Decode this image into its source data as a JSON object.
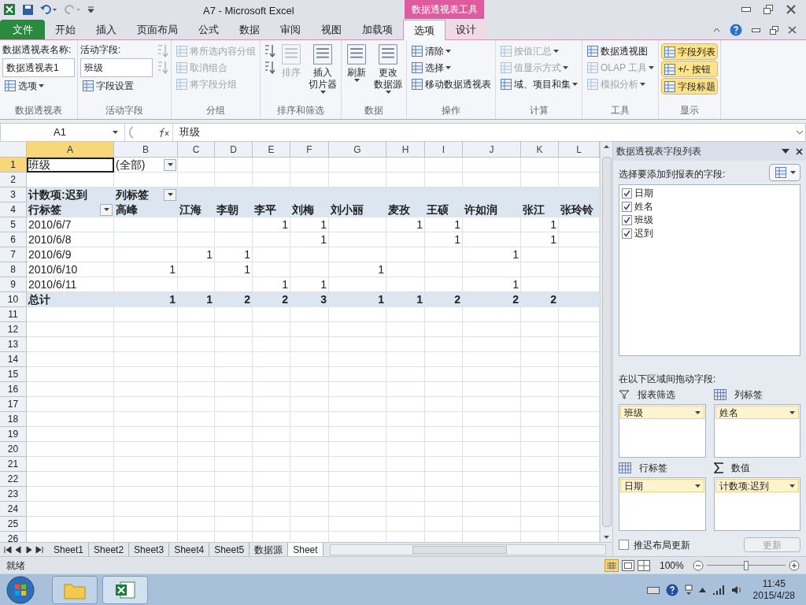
{
  "window": {
    "title": "A7  -  Microsoft Excel",
    "context_title": "数据透视表工具"
  },
  "tabs": [
    {
      "label": "文件",
      "kind": "file",
      "selected": false
    },
    {
      "label": "开始",
      "kind": "normal",
      "selected": false
    },
    {
      "label": "插入",
      "kind": "normal",
      "selected": false
    },
    {
      "label": "页面布局",
      "kind": "normal",
      "selected": false
    },
    {
      "label": "公式",
      "kind": "normal",
      "selected": false
    },
    {
      "label": "数据",
      "kind": "normal",
      "selected": false
    },
    {
      "label": "审阅",
      "kind": "normal",
      "selected": false
    },
    {
      "label": "视图",
      "kind": "normal",
      "selected": false
    },
    {
      "label": "加载项",
      "kind": "normal",
      "selected": false
    },
    {
      "label": "选项",
      "kind": "context",
      "selected": true
    },
    {
      "label": "设计",
      "kind": "context",
      "selected": false
    }
  ],
  "ribbon": [
    {
      "label": "数据透视表",
      "columns": [
        [
          {
            "kind": "field",
            "caption": "数据透视表名称:",
            "value": "数据透视表1"
          },
          {
            "kind": "small",
            "text": "选项",
            "dropdown": true,
            "disabled": false
          }
        ]
      ]
    },
    {
      "label": "活动字段",
      "columns": [
        [
          {
            "kind": "field",
            "caption": "活动字段:",
            "value": "班级"
          },
          {
            "kind": "small",
            "text": "字段设置",
            "dropdown": false,
            "disabled": false
          }
        ],
        [
          {
            "kind": "icon",
            "disabled": true
          },
          {
            "kind": "icon",
            "disabled": true
          }
        ]
      ]
    },
    {
      "label": "分组",
      "columns": [
        [
          {
            "kind": "small",
            "text": "将所选内容分组",
            "dropdown": false,
            "disabled": true
          },
          {
            "kind": "small",
            "text": "取消组合",
            "dropdown": false,
            "disabled": true
          },
          {
            "kind": "small",
            "text": "将字段分组",
            "dropdown": false,
            "disabled": true
          }
        ]
      ]
    },
    {
      "label": "排序和筛选",
      "columns": [
        [
          {
            "kind": "icon",
            "disabled": false
          },
          {
            "kind": "icon",
            "disabled": false
          }
        ],
        [
          {
            "kind": "large",
            "lines": [
              "排序"
            ],
            "dropdown": false,
            "disabled": true
          }
        ],
        [
          {
            "kind": "large",
            "lines": [
              "插入",
              "切片器"
            ],
            "dropdown": true,
            "disabled": false
          }
        ]
      ]
    },
    {
      "label": "数据",
      "columns": [
        [
          {
            "kind": "large",
            "lines": [
              "刷新"
            ],
            "dropdown": true,
            "disabled": false
          }
        ],
        [
          {
            "kind": "large",
            "lines": [
              "更改",
              "数据源"
            ],
            "dropdown": true,
            "disabled": false
          }
        ]
      ]
    },
    {
      "label": "操作",
      "columns": [
        [
          {
            "kind": "small",
            "text": "清除",
            "dropdown": true,
            "disabled": false
          },
          {
            "kind": "small",
            "text": "选择",
            "dropdown": true,
            "disabled": false
          },
          {
            "kind": "small",
            "text": "移动数据透视表",
            "dropdown": false,
            "disabled": false
          }
        ]
      ]
    },
    {
      "label": "计算",
      "columns": [
        [
          {
            "kind": "small",
            "text": "按值汇总",
            "dropdown": true,
            "disabled": true
          },
          {
            "kind": "small",
            "text": "值显示方式",
            "dropdown": true,
            "disabled": true
          },
          {
            "kind": "small",
            "text": "域、项目和集",
            "dropdown": true,
            "disabled": false
          }
        ]
      ]
    },
    {
      "label": "工具",
      "columns": [
        [
          {
            "kind": "small",
            "text": "数据透视图",
            "dropdown": false,
            "disabled": false
          },
          {
            "kind": "small",
            "text": "OLAP 工具",
            "dropdown": true,
            "disabled": true
          },
          {
            "kind": "small",
            "text": "模拟分析",
            "dropdown": true,
            "disabled": true
          }
        ]
      ]
    },
    {
      "label": "显示",
      "columns": [
        [
          {
            "kind": "toggle",
            "text": "字段列表",
            "selected": true
          },
          {
            "kind": "toggle",
            "text": "+/- 按钮",
            "selected": true
          },
          {
            "kind": "toggle",
            "text": "字段标题",
            "selected": true
          }
        ]
      ]
    }
  ],
  "formula_bar": {
    "name_box": "A1",
    "content": "班级"
  },
  "columns": [
    {
      "label": "A",
      "selected": true
    },
    {
      "label": "B",
      "selected": false
    },
    {
      "label": "C",
      "selected": false
    },
    {
      "label": "D",
      "selected": false
    },
    {
      "label": "E",
      "selected": false
    },
    {
      "label": "F",
      "selected": false
    },
    {
      "label": "G",
      "selected": false
    },
    {
      "label": "H",
      "selected": false
    },
    {
      "label": "I",
      "selected": false
    },
    {
      "label": "J",
      "selected": false
    },
    {
      "label": "K",
      "selected": false
    },
    {
      "label": "L",
      "selected": false
    }
  ],
  "rows": [
    {
      "number": "1",
      "kind": "filter",
      "selected": true,
      "cells": {
        "A": {
          "text": "班级",
          "active": true
        },
        "B": {
          "text": "(全部)",
          "dropdown": true
        }
      }
    },
    {
      "number": "2",
      "kind": "blank",
      "selected": false,
      "cells": {}
    },
    {
      "number": "3",
      "kind": "header",
      "selected": false,
      "cells": {
        "A": {
          "text": "计数项:迟到"
        },
        "B": {
          "text": "列标签",
          "dropdown": true
        }
      }
    },
    {
      "number": "4",
      "kind": "header",
      "selected": false,
      "cells": {
        "A": {
          "text": "行标签",
          "dropdown": true
        },
        "B": {
          "text": "高峰"
        },
        "C": {
          "text": "江海"
        },
        "D": {
          "text": "李朝"
        },
        "E": {
          "text": "李平"
        },
        "F": {
          "text": "刘梅"
        },
        "G": {
          "text": "刘小丽"
        },
        "H": {
          "text": "麦孜"
        },
        "I": {
          "text": "王硕"
        },
        "J": {
          "text": "许如润"
        },
        "K": {
          "text": "张江"
        },
        "L": {
          "text": "张玲铃"
        }
      }
    },
    {
      "number": "5",
      "kind": "data",
      "selected": false,
      "cells": {
        "A": {
          "text": "2010/6/7"
        },
        "E": {
          "text": "1"
        },
        "F": {
          "text": "1"
        },
        "H": {
          "text": "1"
        },
        "I": {
          "text": "1"
        },
        "K": {
          "text": "1"
        }
      }
    },
    {
      "number": "6",
      "kind": "data",
      "selected": false,
      "cells": {
        "A": {
          "text": "2010/6/8"
        },
        "F": {
          "text": "1"
        },
        "I": {
          "text": "1"
        },
        "K": {
          "text": "1"
        }
      }
    },
    {
      "number": "7",
      "kind": "data",
      "selected": false,
      "cells": {
        "A": {
          "text": "2010/6/9"
        },
        "C": {
          "text": "1"
        },
        "D": {
          "text": "1"
        },
        "J": {
          "text": "1"
        }
      }
    },
    {
      "number": "8",
      "kind": "data",
      "selected": false,
      "cells": {
        "A": {
          "text": "2010/6/10"
        },
        "B": {
          "text": "1"
        },
        "D": {
          "text": "1"
        },
        "G": {
          "text": "1"
        }
      }
    },
    {
      "number": "9",
      "kind": "data",
      "selected": false,
      "cells": {
        "A": {
          "text": "2010/6/11"
        },
        "E": {
          "text": "1"
        },
        "F": {
          "text": "1"
        },
        "J": {
          "text": "1"
        }
      }
    },
    {
      "number": "10",
      "kind": "total",
      "selected": false,
      "cells": {
        "A": {
          "text": "总计"
        },
        "B": {
          "text": "1"
        },
        "C": {
          "text": "1"
        },
        "D": {
          "text": "2"
        },
        "E": {
          "text": "2"
        },
        "F": {
          "text": "3"
        },
        "G": {
          "text": "1"
        },
        "H": {
          "text": "1"
        },
        "I": {
          "text": "2"
        },
        "J": {
          "text": "2"
        },
        "K": {
          "text": "2"
        }
      }
    },
    {
      "number": "11",
      "kind": "blank",
      "selected": false,
      "cells": {}
    },
    {
      "number": "12",
      "kind": "blank",
      "selected": false,
      "cells": {}
    },
    {
      "number": "13",
      "kind": "blank",
      "selected": false,
      "cells": {}
    },
    {
      "number": "14",
      "kind": "blank",
      "selected": false,
      "cells": {}
    },
    {
      "number": "15",
      "kind": "blank",
      "selected": false,
      "cells": {}
    },
    {
      "number": "16",
      "kind": "blank",
      "selected": false,
      "cells": {}
    },
    {
      "number": "17",
      "kind": "blank",
      "selected": false,
      "cells": {}
    },
    {
      "number": "18",
      "kind": "blank",
      "selected": false,
      "cells": {}
    },
    {
      "number": "19",
      "kind": "blank",
      "selected": false,
      "cells": {}
    },
    {
      "number": "20",
      "kind": "blank",
      "selected": false,
      "cells": {}
    },
    {
      "number": "21",
      "kind": "blank",
      "selected": false,
      "cells": {}
    },
    {
      "number": "22",
      "kind": "blank",
      "selected": false,
      "cells": {}
    },
    {
      "number": "23",
      "kind": "blank",
      "selected": false,
      "cells": {}
    },
    {
      "number": "24",
      "kind": "blank",
      "selected": false,
      "cells": {}
    },
    {
      "number": "25",
      "kind": "blank",
      "selected": false,
      "cells": {}
    },
    {
      "number": "26",
      "kind": "blank",
      "selected": false,
      "cells": {}
    }
  ],
  "sheet_tabs": [
    {
      "label": "Sheet1",
      "selected": false
    },
    {
      "label": "Sheet2",
      "selected": false
    },
    {
      "label": "Sheet3",
      "selected": false
    },
    {
      "label": "Sheet4",
      "selected": false
    },
    {
      "label": "Sheet5",
      "selected": false
    },
    {
      "label": "数据源",
      "selected": false
    },
    {
      "label": "Sheet",
      "selected": true
    }
  ],
  "field_list": {
    "title": "数据透视表字段列表",
    "prompt": "选择要添加到报表的字段:",
    "fields": [
      {
        "label": "日期",
        "checked": true
      },
      {
        "label": "姓名",
        "checked": true
      },
      {
        "label": "班级",
        "checked": true
      },
      {
        "label": "迟到",
        "checked": true
      }
    ],
    "areas_prompt": "在以下区域间拖动字段:",
    "areas": [
      {
        "kind": "filter",
        "title": "报表筛选",
        "items": [
          "班级"
        ]
      },
      {
        "kind": "columns",
        "title": "列标签",
        "items": [
          "姓名"
        ]
      },
      {
        "kind": "rows",
        "title": "行标签",
        "items": [
          "日期"
        ]
      },
      {
        "kind": "values",
        "title": "数值",
        "items": [
          "计数项:迟到"
        ]
      }
    ],
    "defer": {
      "label": "推迟布局更新",
      "checked": false
    },
    "update": {
      "label": "更新",
      "disabled": true
    }
  },
  "status_bar": {
    "text": "就绪",
    "zoom": "100%",
    "level": 0.5
  },
  "taskbar": {
    "time": "11:45",
    "date": "2015/4/28"
  }
}
